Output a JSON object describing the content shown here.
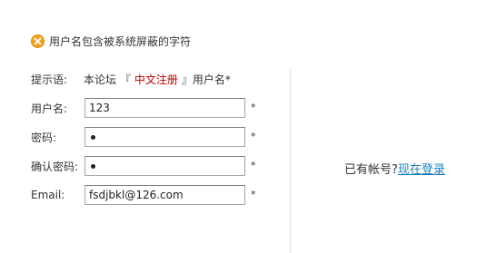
{
  "error": {
    "icon": "error-circle-icon",
    "message": "用户名包含被系统屏蔽的字符"
  },
  "form": {
    "hint": {
      "label": "提示语:",
      "prefix": "本论坛 『",
      "link": "中文注册",
      "suffix": "』用户名*"
    },
    "username": {
      "label": "用户名:",
      "value": "123",
      "required": "*"
    },
    "password": {
      "label": "密码:",
      "required": "*"
    },
    "confirm_password": {
      "label": "确认密码:",
      "required": "*"
    },
    "email": {
      "label": "Email:",
      "value": "fsdjbkl@126.com",
      "required": "*"
    }
  },
  "login": {
    "prompt": "已有帐号?",
    "link": "现在登录"
  },
  "colors": {
    "accent_link": "#c00000",
    "login_link": "#1a7fbf",
    "error_icon": "#f2a41a"
  }
}
